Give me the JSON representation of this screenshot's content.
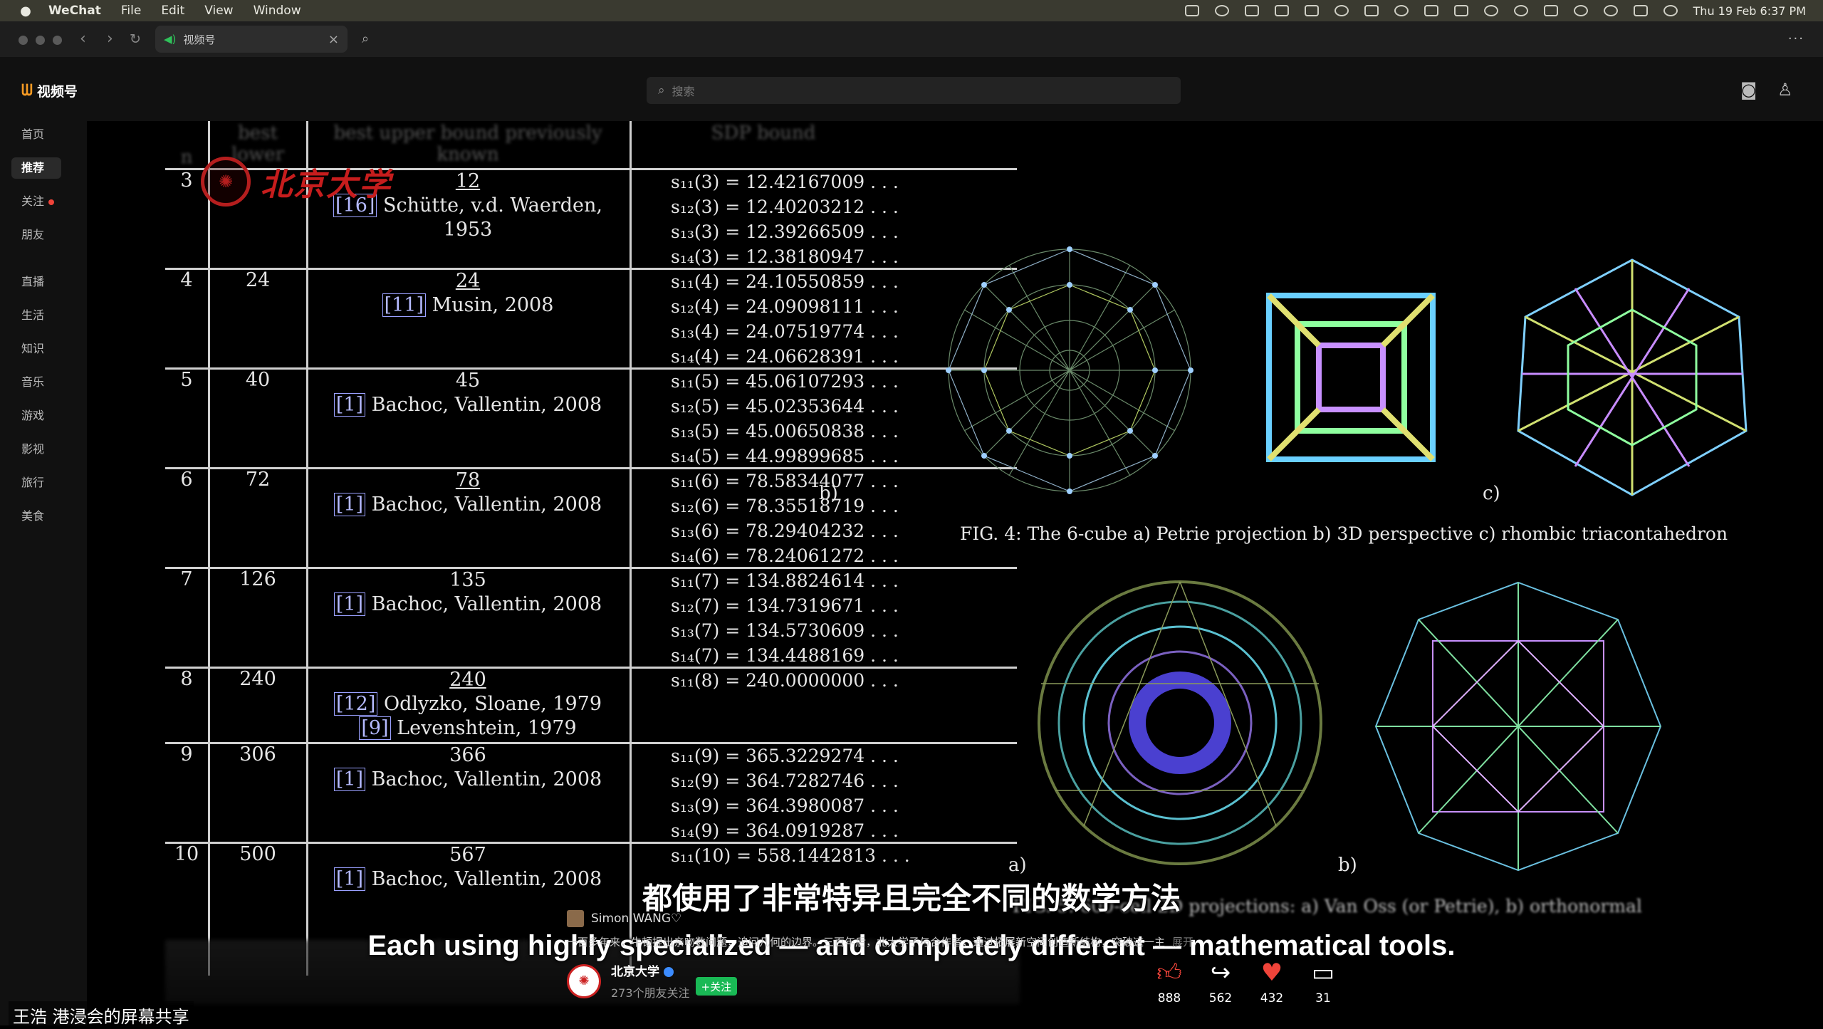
{
  "menubar": {
    "app": "WeChat",
    "menus": [
      "File",
      "Edit",
      "View",
      "Window"
    ],
    "clock": "Thu 19 Feb  6:37 PM"
  },
  "browser": {
    "tab_title": "视频号"
  },
  "header": {
    "logo_text": "视频号",
    "search_placeholder": "搜索"
  },
  "sidebar": {
    "items": [
      "首页",
      "推荐",
      "关注",
      "朋友",
      "直播",
      "生活",
      "知识",
      "音乐",
      "游戏",
      "影视",
      "旅行",
      "美食"
    ]
  },
  "video": {
    "watermark": "北京大学",
    "table_header": [
      "n",
      "best lower",
      "best upper bound previously known",
      "SDP bound"
    ],
    "rows": [
      {
        "n": "3",
        "lower": "",
        "upper": "12",
        "refs": [
          {
            "ref": "[16]",
            "text": "Schütte, v.d. Waerden, 1953"
          }
        ],
        "sdp": [
          "s₁₁(3) = 12.42167009 . . .",
          "s₁₂(3) = 12.40203212 . . .",
          "s₁₃(3) = 12.39266509 . . .",
          "s₁₄(3) = 12.38180947 . . ."
        ]
      },
      {
        "n": "4",
        "lower": "24",
        "upper": "24",
        "refs": [
          {
            "ref": "[11]",
            "text": "Musin, 2008"
          }
        ],
        "sdp": [
          "s₁₁(4) = 24.10550859 . . .",
          "s₁₂(4) = 24.09098111 . . .",
          "s₁₃(4) = 24.07519774 . . .",
          "s₁₄(4) = 24.06628391 . . ."
        ]
      },
      {
        "n": "5",
        "lower": "40",
        "upper": "45",
        "refs": [
          {
            "ref": "[1]",
            "text": "Bachoc, Vallentin, 2008"
          }
        ],
        "sdp": [
          "s₁₁(5) = 45.06107293 . . .",
          "s₁₂(5) = 45.02353644 . . .",
          "s₁₃(5) = 45.00650838 . . .",
          "s₁₄(5) = 44.99899685 . . ."
        ]
      },
      {
        "n": "6",
        "lower": "72",
        "upper": "78",
        "refs": [
          {
            "ref": "[1]",
            "text": "Bachoc, Vallentin, 2008"
          }
        ],
        "sdp": [
          "s₁₁(6) = 78.58344077 . . .",
          "s₁₂(6) = 78.35518719 . . .",
          "s₁₃(6) = 78.29404232 . . .",
          "s₁₄(6) = 78.24061272 . . ."
        ]
      },
      {
        "n": "7",
        "lower": "126",
        "upper": "135",
        "refs": [
          {
            "ref": "[1]",
            "text": "Bachoc, Vallentin, 2008"
          }
        ],
        "sdp": [
          "s₁₁(7) = 134.8824614 . . .",
          "s₁₂(7) = 134.7319671 . . .",
          "s₁₃(7) = 134.5730609 . . .",
          "s₁₄(7) = 134.4488169 . . ."
        ]
      },
      {
        "n": "8",
        "lower": "240",
        "upper": "240",
        "refs": [
          {
            "ref": "[12]",
            "text": "Odlyzko, Sloane, 1979"
          },
          {
            "ref": "[9]",
            "text": "Levenshtein, 1979"
          }
        ],
        "sdp": [
          "s₁₁(8) = 240.0000000 . . ."
        ]
      },
      {
        "n": "9",
        "lower": "306",
        "upper": "366",
        "refs": [
          {
            "ref": "[1]",
            "text": "Bachoc, Vallentin, 2008"
          }
        ],
        "sdp": [
          "s₁₁(9) = 365.3229274 . . .",
          "s₁₂(9) = 364.7282746 . . .",
          "s₁₃(9) = 364.3980087 . . .",
          "s₁₄(9) = 364.0919287 . . ."
        ]
      },
      {
        "n": "10",
        "lower": "500",
        "upper": "567",
        "refs": [
          {
            "ref": "[1]",
            "text": "Bachoc, Vallentin, 2008"
          }
        ],
        "sdp": [
          "s₁₁(10) = 558.1442813 . . ."
        ]
      }
    ],
    "fig4_labels": [
      "b)",
      "c)"
    ],
    "fig4_caption": "FIG. 4: The 6-cube a) Petrie projection b) 3D perspective c) rhombic triacontahedron",
    "fig5_labels": [
      "a)",
      "b)"
    ],
    "fig5_caption": "FIG. 5: 600-cell 2D projections: a) Van Oss (or Petrie), b) orthonormal"
  },
  "overlay": {
    "subtitle_cn": "都使用了非常特异且完全不同的数学方法",
    "subtitle_en": "Each using highly specialized — and completely different — mathematical tools.",
    "author": "Simon WANG♡",
    "description": "一百多年来，牛顿提出亲吻数问题，追问几何的边界。三百年后，北大学子与合作者，通过拓展新空间创造新结构，突破这一主",
    "expand": "展开",
    "account_name": "北京大学",
    "fans": "273个朋友关注",
    "follow": "+关注",
    "likes": "888",
    "shares": "562",
    "hearts": "432",
    "comments": "31",
    "screen_share": "王浩 港浸会的屏幕共享"
  }
}
